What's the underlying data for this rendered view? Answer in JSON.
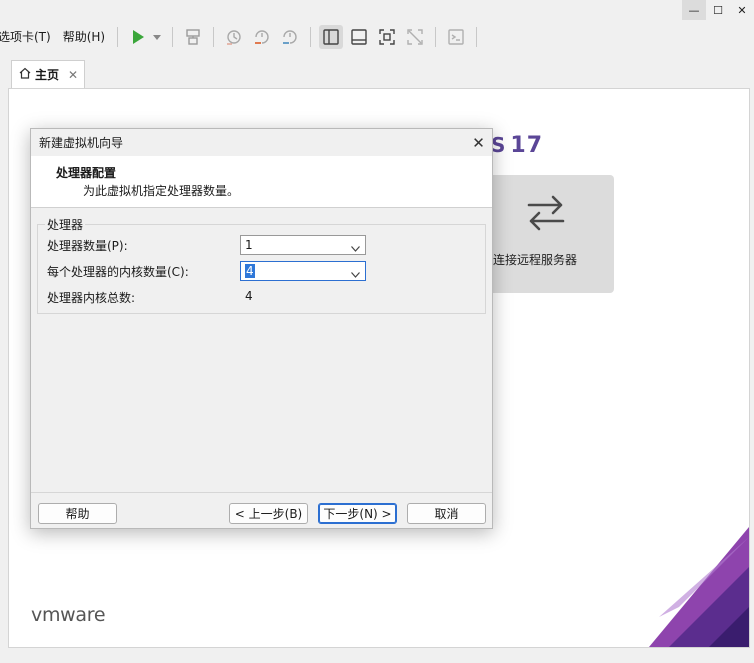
{
  "menu": {
    "tabs_label": "选项卡(T)",
    "help_label": "帮助(H)"
  },
  "tab": {
    "label": "主页",
    "close": "✕"
  },
  "home": {
    "version_fragment": "S",
    "version": "17",
    "remote_label": "连接远程服务器",
    "logo": "vmware"
  },
  "dialog": {
    "title": "新建虚拟机向导",
    "header_title": "处理器配置",
    "header_subtitle": "为此虚拟机指定处理器数量。",
    "group_label": "处理器",
    "processor_count_label": "处理器数量(P):",
    "processor_count_value": "1",
    "cores_label": "每个处理器的内核数量(C):",
    "cores_value": "4",
    "total_label": "处理器内核总数:",
    "total_value": "4",
    "buttons": {
      "help": "帮助",
      "back": "< 上一步(B)",
      "next": "下一步(N) >",
      "cancel": "取消"
    }
  },
  "colors": {
    "accent": "#5b4697",
    "focus": "#2c6fd1",
    "play": "#3aa63a"
  }
}
